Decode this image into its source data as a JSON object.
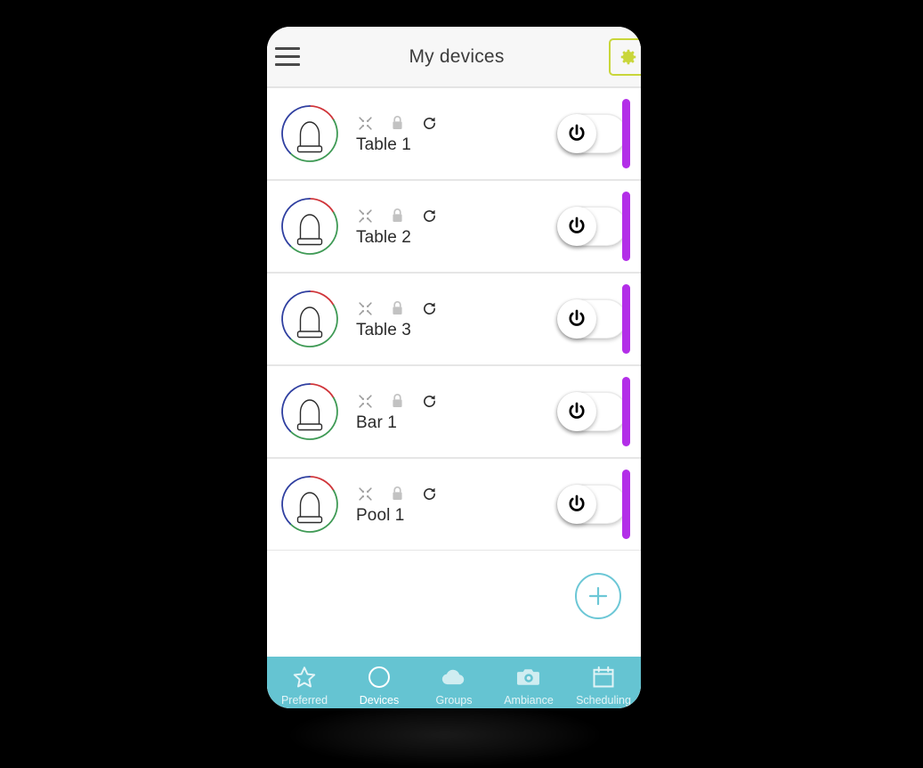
{
  "header": {
    "title": "My devices",
    "menu_icon": "hamburger-menu-icon",
    "settings_icon": "gear-icon",
    "accent_color": "#c9d63a"
  },
  "devices": [
    {
      "name": "Table 1",
      "power": "off",
      "status_color": "#b32ee8",
      "icons": [
        "collapse-icon",
        "lock-icon",
        "refresh-icon"
      ]
    },
    {
      "name": "Table 2",
      "power": "off",
      "status_color": "#b32ee8",
      "icons": [
        "collapse-icon",
        "lock-icon",
        "refresh-icon"
      ]
    },
    {
      "name": "Table 3",
      "power": "off",
      "status_color": "#b32ee8",
      "icons": [
        "collapse-icon",
        "lock-icon",
        "refresh-icon"
      ]
    },
    {
      "name": "Bar 1",
      "power": "off",
      "status_color": "#b32ee8",
      "icons": [
        "collapse-icon",
        "lock-icon",
        "refresh-icon"
      ]
    },
    {
      "name": "Pool 1",
      "power": "off",
      "status_color": "#b32ee8",
      "icons": [
        "collapse-icon",
        "lock-icon",
        "refresh-icon"
      ]
    }
  ],
  "fab": {
    "icon": "plus-icon",
    "color": "#6cc7d6"
  },
  "bottom_nav": {
    "background": "#65c4d2",
    "items": [
      {
        "label": "Preferred",
        "icon": "star-icon",
        "active": false
      },
      {
        "label": "Devices",
        "icon": "circle-icon",
        "active": true
      },
      {
        "label": "Groups",
        "icon": "cloud-icon",
        "active": false
      },
      {
        "label": "Ambiance",
        "icon": "camera-icon",
        "active": false
      },
      {
        "label": "Scheduling",
        "icon": "calendar-icon",
        "active": false
      }
    ]
  },
  "lamp_icon": {
    "ring_colors": {
      "red": "#d0353a",
      "green": "#3f9a55",
      "blue": "#2f3fa0"
    },
    "body_color": "#2b2b2b"
  }
}
